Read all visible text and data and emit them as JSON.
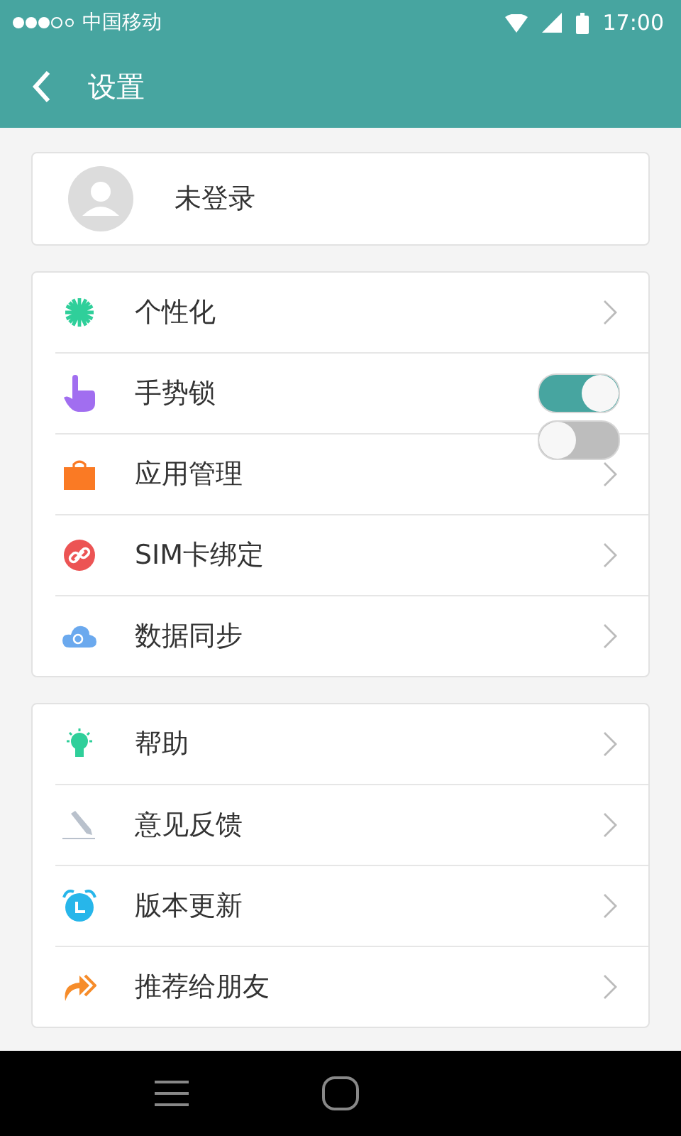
{
  "status_bar": {
    "carrier": "中国移动",
    "time": "17:00"
  },
  "header": {
    "title": "设置"
  },
  "account": {
    "label": "未登录"
  },
  "groups": [
    {
      "items": [
        {
          "kind": "link",
          "label": "个性化"
        },
        {
          "kind": "toggle",
          "label": "手势锁",
          "toggles": [
            {
              "on": true
            },
            {
              "on": false
            }
          ]
        },
        {
          "kind": "link",
          "label": "应用管理"
        },
        {
          "kind": "link",
          "label": "SIM卡绑定"
        },
        {
          "kind": "link",
          "label": "数据同步"
        }
      ]
    },
    {
      "items": [
        {
          "kind": "link",
          "label": "帮助"
        },
        {
          "kind": "link",
          "label": "意见反馈"
        },
        {
          "kind": "link",
          "label": "版本更新"
        },
        {
          "kind": "link",
          "label": "推荐给朋友"
        }
      ]
    }
  ]
}
